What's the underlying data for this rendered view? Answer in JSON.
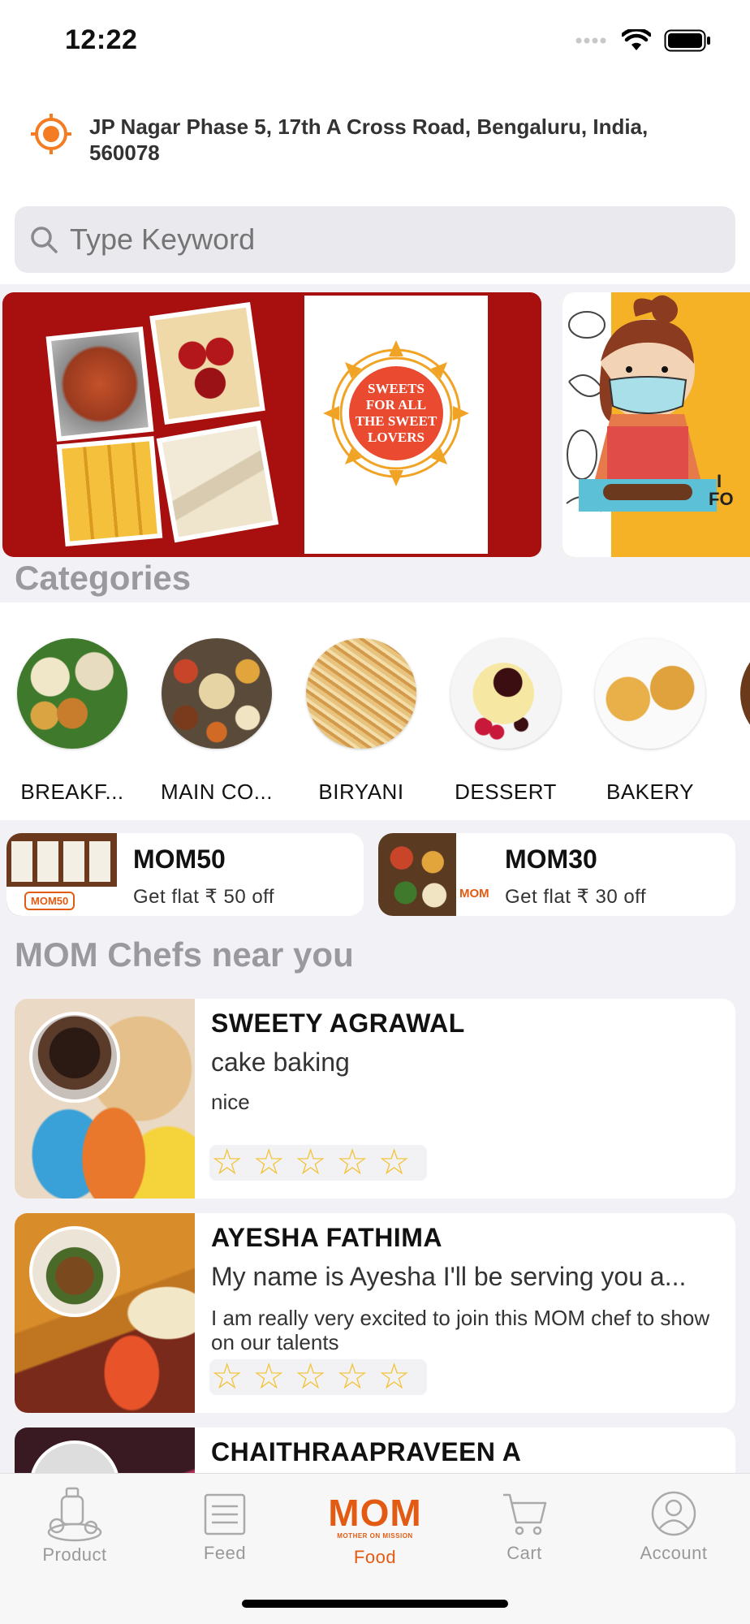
{
  "status": {
    "time": "12:22"
  },
  "location": {
    "address": "JP Nagar Phase 5, 17th A Cross Road, Bengaluru, India, 560078"
  },
  "search": {
    "placeholder": "Type Keyword"
  },
  "banners": [
    {
      "badge_lines": [
        "SWEETS",
        "FOR ALL",
        "THE SWEET",
        "LOVERS"
      ],
      "color": "#a81010"
    },
    {
      "color": "#f6b226"
    }
  ],
  "categories": {
    "title": "Categories",
    "items": [
      {
        "label": "BREAKF..."
      },
      {
        "label": "MAIN CO..."
      },
      {
        "label": "BIRYANI"
      },
      {
        "label": "DESSERT"
      },
      {
        "label": "BAKERY"
      }
    ]
  },
  "coupons": [
    {
      "code": "MOM50",
      "desc": "Get flat ₹ 50 off",
      "img_label": "MOM50"
    },
    {
      "code": "MOM30",
      "desc": "Get flat ₹ 30 off",
      "img_label": "MOM"
    }
  ],
  "chefs": {
    "title": "MOM Chefs near you",
    "items": [
      {
        "name": "SWEETY AGRAWAL",
        "specialty": "cake baking",
        "bio": "nice",
        "rating": 0
      },
      {
        "name": "AYESHA FATHIMA",
        "specialty": "My name is Ayesha I'll be serving you a...",
        "bio": "I am really very excited to join this MOM chef to show on our talents",
        "rating": 0
      },
      {
        "name": "CHAITHRAAPRAVEEN A"
      }
    ]
  },
  "tabs": [
    {
      "label": "Product",
      "icon": "product-icon",
      "active": false
    },
    {
      "label": "Feed",
      "icon": "feed-icon",
      "active": false
    },
    {
      "label": "Food",
      "icon": "mom-logo-icon",
      "active": true,
      "logo_text": "MOM",
      "logo_sub": "MOTHER ON MISSION"
    },
    {
      "label": "Cart",
      "icon": "cart-icon",
      "active": false
    },
    {
      "label": "Account",
      "icon": "account-icon",
      "active": false
    }
  ],
  "colors": {
    "accent": "#e35b13",
    "star": "#f3c230",
    "background": "#f2f1f6"
  }
}
